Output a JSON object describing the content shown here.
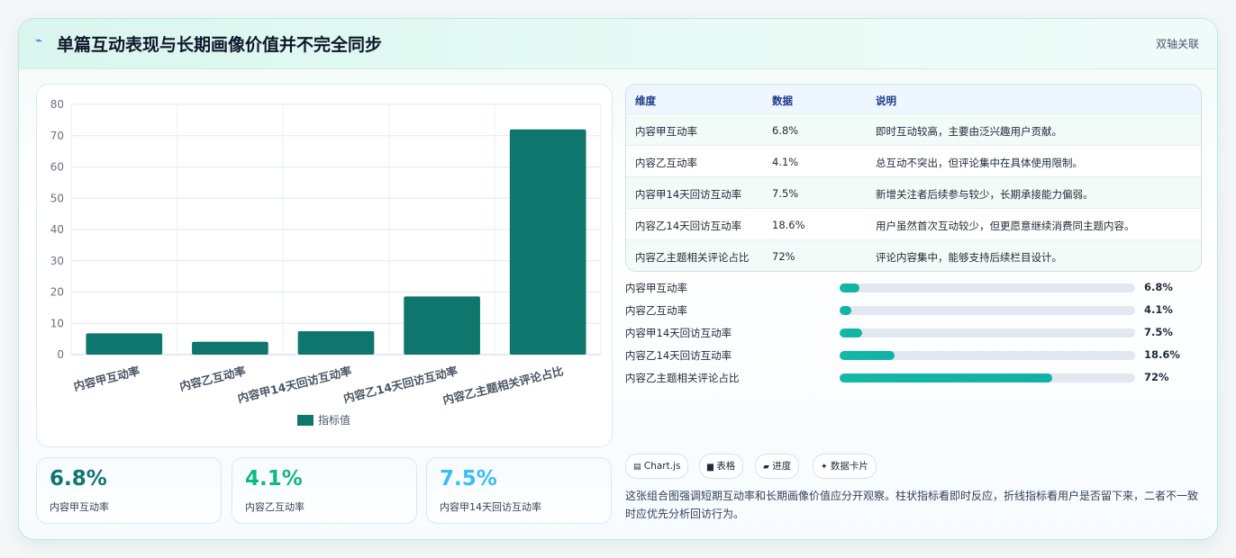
{
  "header": {
    "icon": "sparkle-icon",
    "title": "单篇互动表现与长期画像价值并不完全同步",
    "tag": "双轴关联"
  },
  "chart_data": {
    "type": "bar",
    "categories": [
      "内容甲互动率",
      "内容乙互动率",
      "内容甲14天回访互动率",
      "内容乙14天回访互动率",
      "内容乙主题相关评论占比"
    ],
    "series": [
      {
        "name": "指标值",
        "values": [
          6.8,
          4.1,
          7.5,
          18.6,
          72
        ],
        "color": "#0f766e"
      }
    ],
    "ylim": [
      0,
      80
    ],
    "yticks": [
      0,
      10,
      20,
      30,
      40,
      50,
      60,
      70,
      80
    ],
    "grid": true,
    "legend_position": "bottom"
  },
  "kpis": [
    {
      "value": "6.8%",
      "label": "内容甲互动率",
      "color": "#0f766e"
    },
    {
      "value": "4.1%",
      "label": "内容乙互动率",
      "color": "#10b981"
    },
    {
      "value": "7.5%",
      "label": "内容甲14天回访互动率",
      "color": "#38bdf8"
    }
  ],
  "table": {
    "headers": [
      "维度",
      "数据",
      "说明"
    ],
    "rows": [
      [
        "内容甲互动率",
        "6.8%",
        "即时互动较高，主要由泛兴趣用户贡献。"
      ],
      [
        "内容乙互动率",
        "4.1%",
        "总互动不突出，但评论集中在具体使用限制。"
      ],
      [
        "内容甲14天回访互动率",
        "7.5%",
        "新增关注者后续参与较少，长期承接能力偏弱。"
      ],
      [
        "内容乙14天回访互动率",
        "18.6%",
        "用户虽然首次互动较少，但更愿意继续消费同主题内容。"
      ],
      [
        "内容乙主题相关评论占比",
        "72%",
        "评论内容集中，能够支持后续栏目设计。"
      ]
    ]
  },
  "progress": [
    {
      "label": "内容甲互动率",
      "value": 6.8,
      "text": "6.8%"
    },
    {
      "label": "内容乙互动率",
      "value": 4.1,
      "text": "4.1%"
    },
    {
      "label": "内容甲14天回访互动率",
      "value": 7.5,
      "text": "7.5%"
    },
    {
      "label": "内容乙14天回访互动率",
      "value": 18.6,
      "text": "18.6%"
    },
    {
      "label": "内容乙主题相关评论占比",
      "value": 72,
      "text": "72%"
    }
  ],
  "chips": [
    {
      "icon": "chart-icon",
      "glyph": "▤",
      "label": "Chart.js"
    },
    {
      "icon": "table-icon",
      "glyph": "▆",
      "label": "表格"
    },
    {
      "icon": "progress-icon",
      "glyph": "▰",
      "label": "进度"
    },
    {
      "icon": "sparkle-icon",
      "glyph": "✦",
      "label": "数据卡片"
    }
  ],
  "note": "这张组合图强调短期互动率和长期画像价值应分开观察。柱状指标看即时反应，折线指标看用户是否留下来，二者不一致时应优先分析回访行为。"
}
